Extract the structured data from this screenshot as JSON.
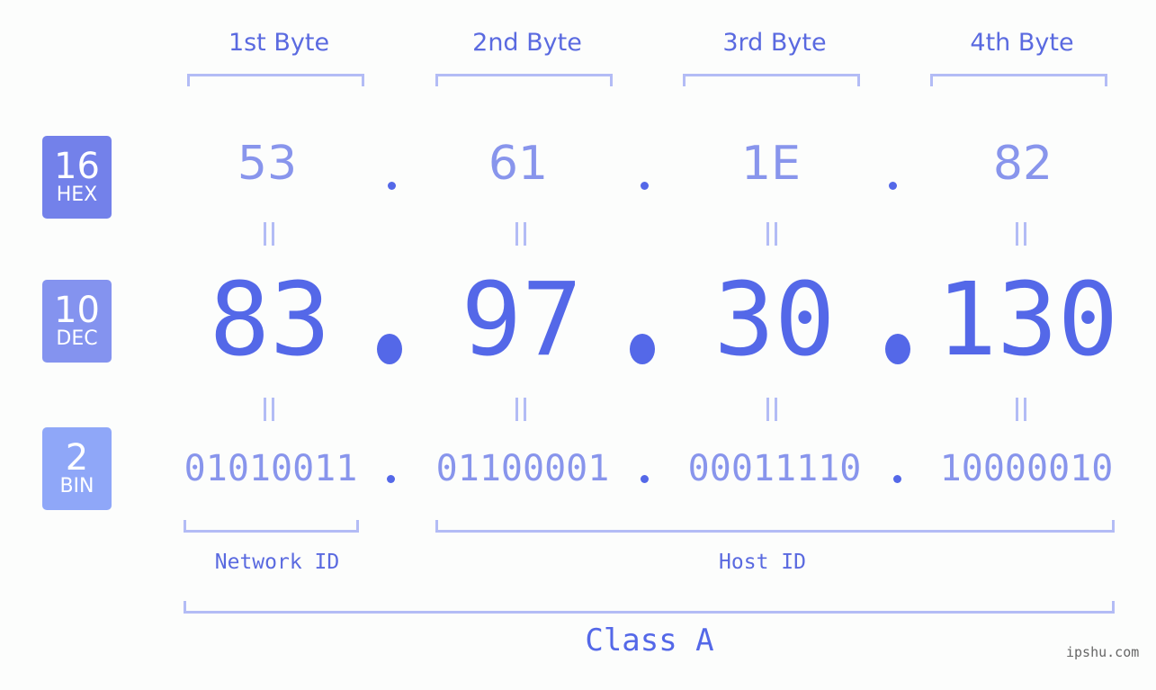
{
  "headers": [
    "1st Byte",
    "2nd Byte",
    "3rd Byte",
    "4th Byte"
  ],
  "badges": [
    {
      "num": "16",
      "label": "HEX",
      "color": "#7381ea"
    },
    {
      "num": "10",
      "label": "DEC",
      "color": "#8493ef"
    },
    {
      "num": "2",
      "label": "BIN",
      "color": "#8fa7f8"
    }
  ],
  "hex": [
    "53",
    "61",
    "1E",
    "82"
  ],
  "dec": [
    "83",
    "97",
    "30",
    "130"
  ],
  "bin": [
    "01010011",
    "01100001",
    "00011110",
    "10000010"
  ],
  "network_label": "Network ID",
  "host_label": "Host ID",
  "class_label": "Class A",
  "watermark": "ipshu.com",
  "colors": {
    "accent": "#5468e8",
    "light": "#8895ec",
    "bracket": "#b3bcf5"
  }
}
